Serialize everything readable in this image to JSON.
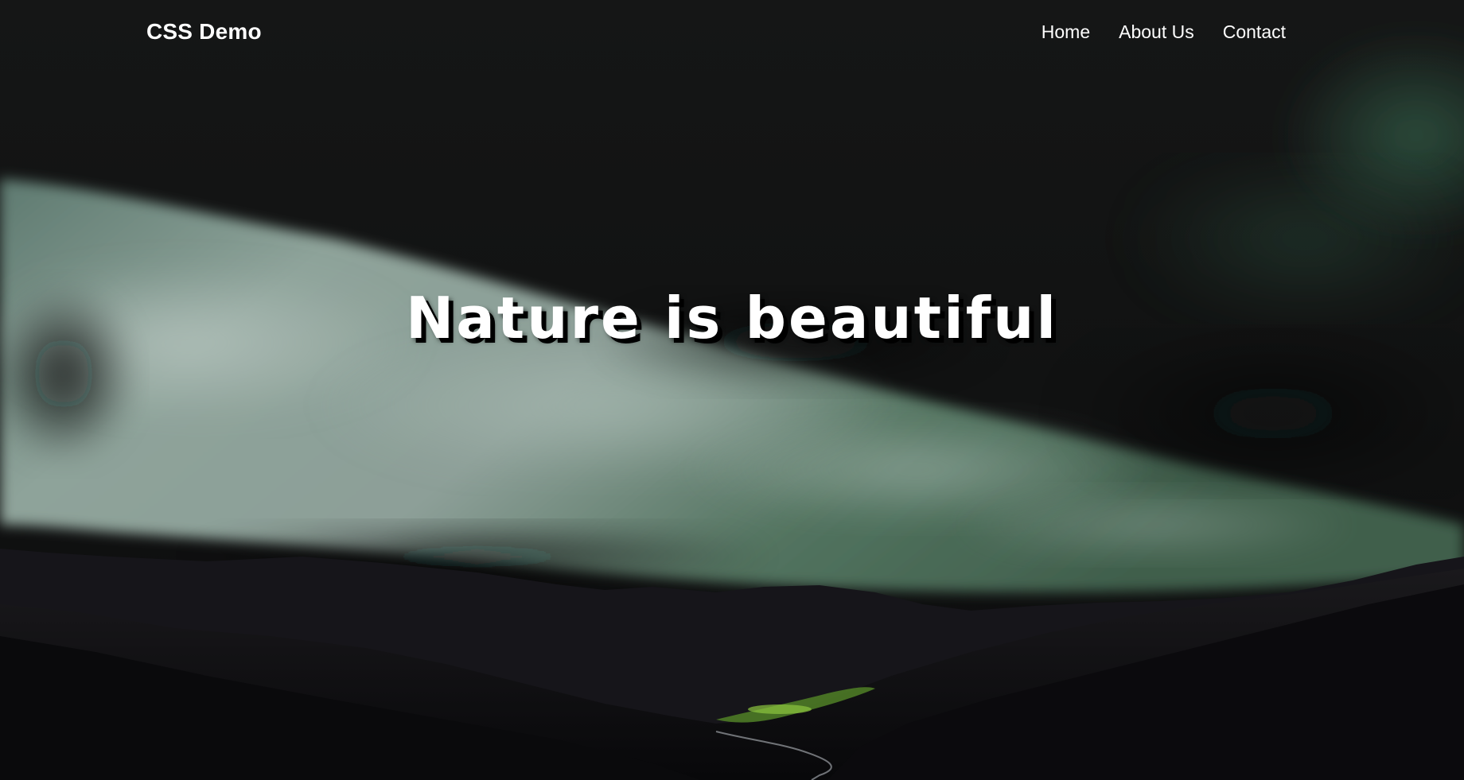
{
  "header": {
    "brand": "CSS Demo",
    "nav": [
      {
        "label": "Home"
      },
      {
        "label": "About Us"
      },
      {
        "label": "Contact"
      }
    ]
  },
  "hero": {
    "title": "Nature is beautiful",
    "background_image": "dark-stormy-sky-over-mountain-valley",
    "colors": {
      "sky": "#121313",
      "cloud_light": "#9fb2aa",
      "cloud_green": "#3d6e57",
      "mountains": "#111012",
      "valley_green": "#7fb83a",
      "text": "#ffffff"
    }
  }
}
